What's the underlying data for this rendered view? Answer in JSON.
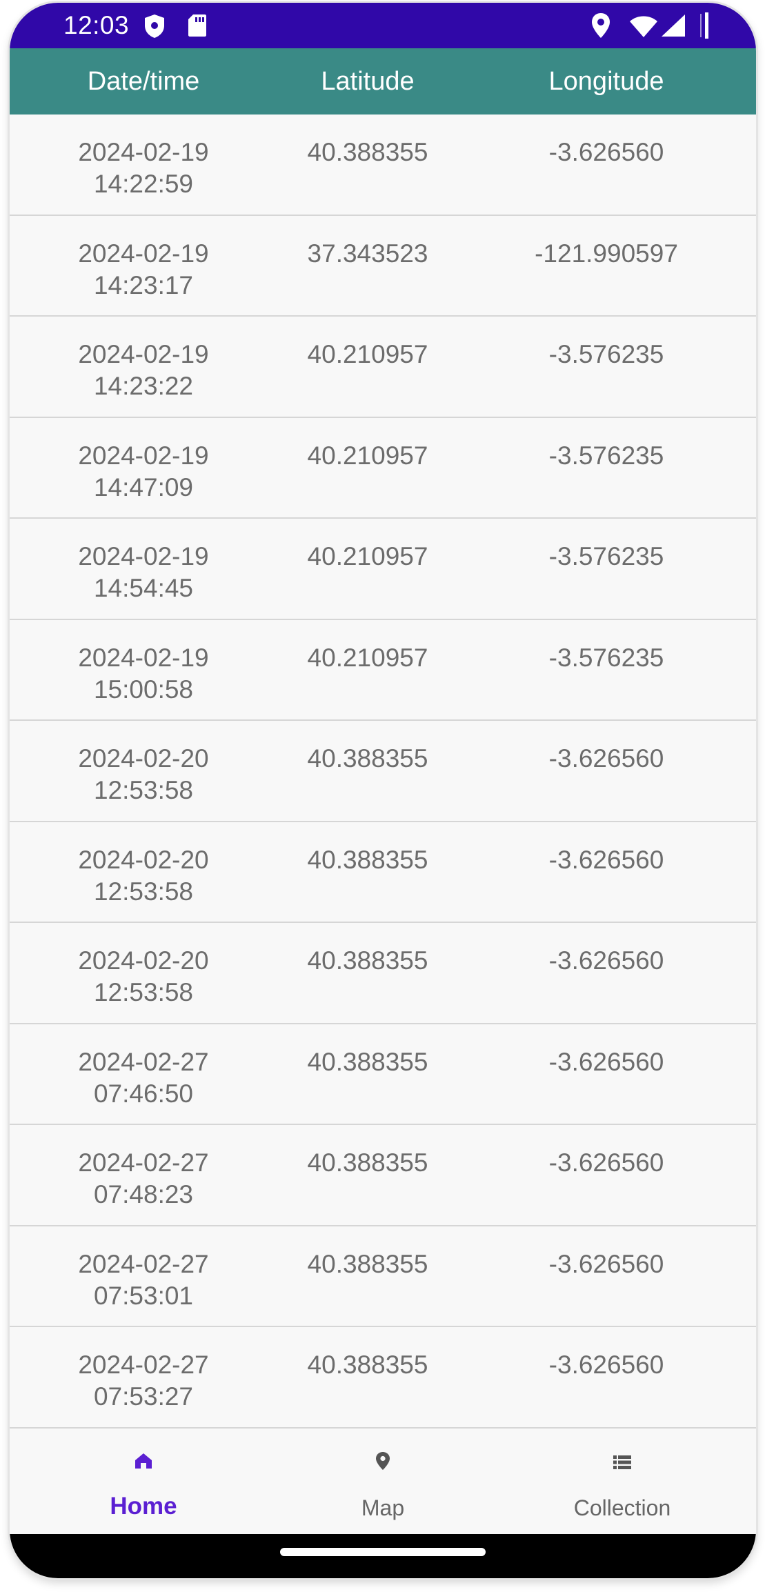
{
  "status_bar": {
    "time": "12:03",
    "icons": [
      "shield-icon",
      "sd-card-icon",
      "location-icon",
      "wifi-icon",
      "signal-icon",
      "battery-icon"
    ]
  },
  "table": {
    "headers": {
      "date": "Date/time",
      "lat": "Latitude",
      "lon": "Longitude"
    },
    "rows": [
      {
        "date": "2024-02-19",
        "time": "14:22:59",
        "lat": "40.388355",
        "lon": "-3.626560"
      },
      {
        "date": "2024-02-19",
        "time": "14:23:17",
        "lat": "37.343523",
        "lon": "-121.990597"
      },
      {
        "date": "2024-02-19",
        "time": "14:23:22",
        "lat": "40.210957",
        "lon": "-3.576235"
      },
      {
        "date": "2024-02-19",
        "time": "14:47:09",
        "lat": "40.210957",
        "lon": "-3.576235"
      },
      {
        "date": "2024-02-19",
        "time": "14:54:45",
        "lat": "40.210957",
        "lon": "-3.576235"
      },
      {
        "date": "2024-02-19",
        "time": "15:00:58",
        "lat": "40.210957",
        "lon": "-3.576235"
      },
      {
        "date": "2024-02-20",
        "time": "12:53:58",
        "lat": "40.388355",
        "lon": "-3.626560"
      },
      {
        "date": "2024-02-20",
        "time": "12:53:58",
        "lat": "40.388355",
        "lon": "-3.626560"
      },
      {
        "date": "2024-02-20",
        "time": "12:53:58",
        "lat": "40.388355",
        "lon": "-3.626560"
      },
      {
        "date": "2024-02-27",
        "time": "07:46:50",
        "lat": "40.388355",
        "lon": "-3.626560"
      },
      {
        "date": "2024-02-27",
        "time": "07:48:23",
        "lat": "40.388355",
        "lon": "-3.626560"
      },
      {
        "date": "2024-02-27",
        "time": "07:53:01",
        "lat": "40.388355",
        "lon": "-3.626560"
      },
      {
        "date": "2024-02-27",
        "time": "07:53:27",
        "lat": "40.388355",
        "lon": "-3.626560"
      }
    ]
  },
  "bottom_nav": {
    "items": [
      {
        "label": "Home",
        "icon": "home-icon",
        "active": true
      },
      {
        "label": "Map",
        "icon": "map-pin-icon",
        "active": false
      },
      {
        "label": "Collection",
        "icon": "list-icon",
        "active": false
      }
    ]
  },
  "colors": {
    "status_bar": "#3008a8",
    "header": "#3a8a86",
    "accent": "#5b1fd2"
  }
}
